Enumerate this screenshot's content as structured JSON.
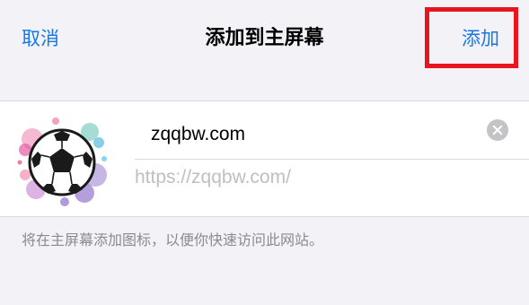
{
  "nav": {
    "cancel_label": "取消",
    "title": "添加到主屏幕",
    "add_label": "添加"
  },
  "bookmark": {
    "name": "zqqbw.com",
    "url": "https://zqqbw.com/",
    "icon": "soccer-ball-icon"
  },
  "footer": {
    "note": "将在主屏幕添加图标，以便你快速访问此网站。"
  },
  "colors": {
    "accent": "#1677e6",
    "highlight": "#e8141e",
    "background": "#f2f2f7"
  }
}
